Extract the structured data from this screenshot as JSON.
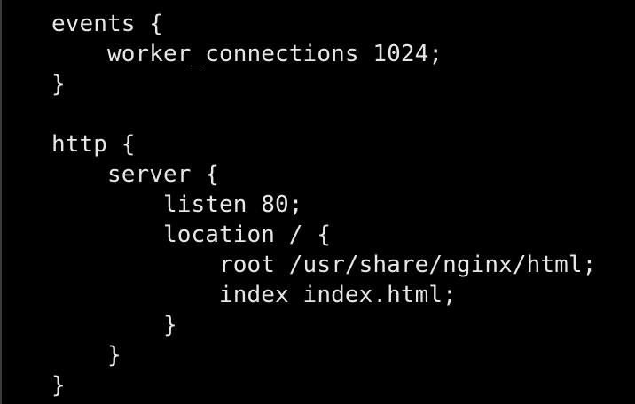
{
  "colors": {
    "background": "#000000",
    "text": "#e6e6e6"
  },
  "code": {
    "lines": [
      "events {",
      "    worker_connections 1024;",
      "}",
      "",
      "http {",
      "    server {",
      "        listen 80;",
      "        location / {",
      "            root /usr/share/nginx/html;",
      "            index index.html;",
      "        }",
      "    }",
      "}"
    ]
  }
}
